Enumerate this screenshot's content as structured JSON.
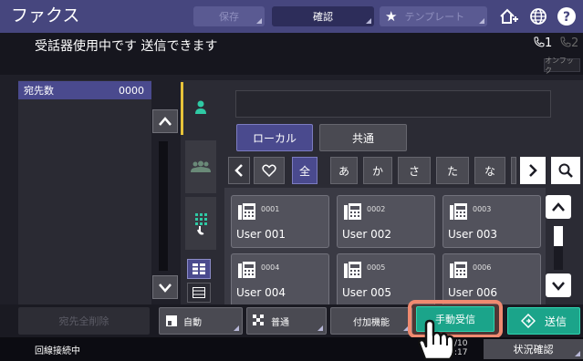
{
  "topbar": {
    "title": "ファクス",
    "save_label": "保存",
    "confirm_label": "確認",
    "template_label": "テンプレート"
  },
  "status": {
    "message": "受話器使用中です 送信できます",
    "line1": "1",
    "line2": "2",
    "online_label": "オンフック"
  },
  "destinations": {
    "count_label": "宛先数",
    "count_value": "0000"
  },
  "address_book": {
    "tabs": [
      "ローカル",
      "共通"
    ],
    "filters": [
      "全",
      "あ",
      "か",
      "さ",
      "た",
      "な"
    ],
    "entries": [
      {
        "number": "0001",
        "name": "User 001"
      },
      {
        "number": "0002",
        "name": "User 002"
      },
      {
        "number": "0003",
        "name": "User 003"
      },
      {
        "number": "0004",
        "name": "User 004"
      },
      {
        "number": "0005",
        "name": "User 005"
      },
      {
        "number": "0006",
        "name": "User 006"
      }
    ]
  },
  "bottom": {
    "delete_all_label": "宛先全削除",
    "auto_label": "自動",
    "normal_label": "普通",
    "options_label": "付加機能",
    "manual_receive_label": "手動受信",
    "send_label": "送信"
  },
  "footer": {
    "status_text": "回線接続中",
    "date": "/10",
    "time": ":17",
    "status_check_label": "状況確認"
  },
  "colors": {
    "topbar": "#46467e",
    "accent": "#e7c33a",
    "active_tab": "#4a4a8e",
    "send_green": "#1ba48a",
    "highlight": "#f08a70"
  }
}
